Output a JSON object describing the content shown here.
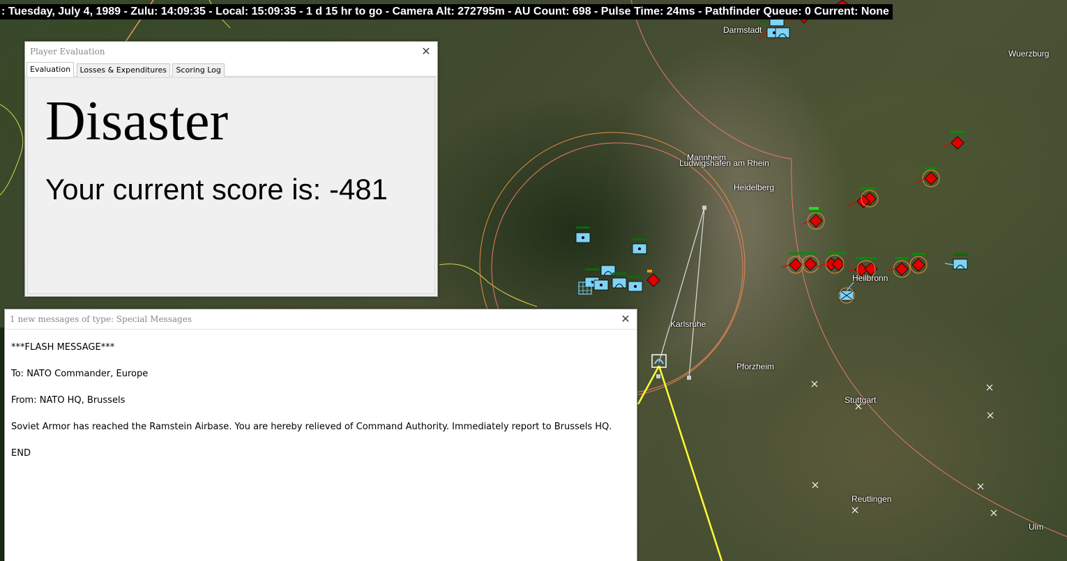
{
  "status_bar": {
    "text": ": Tuesday, July 4, 1989 - Zulu: 14:09:35 - Local: 15:09:35 - 1 d 15 hr to go -  Camera Alt: 272795m - AU Count: 698 - Pulse Time: 24ms - Pathfinder Queue: 0 Current: None"
  },
  "map": {
    "cities": {
      "darmstadt": "Darmstadt",
      "wuerzburg": "Wuerzburg",
      "mannheim": "Mannheim",
      "ludwigshafen": "Ludwigshafen am Rhein",
      "heidelberg": "Heidelberg",
      "heilbronn": "Heilbronn",
      "karlsruhe": "Karlsruhe",
      "pforzheim": "Pforzheim",
      "stuttgart": "Stuttgart",
      "reutlingen": "Reutlingen",
      "ulm": "Ulm"
    },
    "colors": {
      "friendly": "#7fd3f5",
      "hostile": "#e00000",
      "range_ring": "#e87a6a",
      "route_yellow": "#ffff33",
      "border_yellow": "#d8d84a"
    }
  },
  "player_evaluation": {
    "title": "Player Evaluation",
    "tabs": [
      "Evaluation",
      "Losses & Expenditures",
      "Scoring Log"
    ],
    "verdict": "Disaster",
    "score_text": "Your current score is: -481"
  },
  "special_messages": {
    "title": "1 new messages of type: Special Messages",
    "lines": [
      "***FLASH MESSAGE***",
      "To: NATO Commander, Europe",
      "From: NATO HQ, Brussels",
      "Soviet Armor has reached the Ramstein Airbase.  You are hereby relieved of Command Authority.  Immediately report to Brussels HQ.",
      "END"
    ]
  }
}
